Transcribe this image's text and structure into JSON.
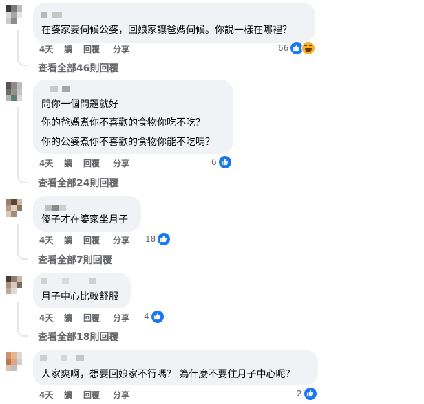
{
  "comments": [
    {
      "lines": [
        "在婆家要伺候公婆，回娘家讓爸媽伺候。你說一樣在哪裡？"
      ],
      "time": "4天",
      "read": "讀",
      "reply": "回覆",
      "share": "分享",
      "reaction_count": "66",
      "reactions": [
        "like-icon",
        "haha-icon"
      ],
      "view_replies": "查看全部46則回覆"
    },
    {
      "lines": [
        "問你一個問題就好",
        "你的爸媽煮你不喜歡的食物你吃不吃？",
        "你的公婆煮你不喜歡的食物你能不吃嗎？"
      ],
      "time": "4天",
      "read": "讀",
      "reply": "回覆",
      "share": "分享",
      "reaction_count": "6",
      "reactions": [
        "like-icon"
      ],
      "view_replies": "查看全部24則回覆"
    },
    {
      "lines": [
        "傻子才在婆家坐月子"
      ],
      "time": "4天",
      "read": "讀",
      "reply": "回覆",
      "share": "分享",
      "reaction_count": "18",
      "reactions": [
        "like-icon"
      ],
      "view_replies": "查看全部7則回覆"
    },
    {
      "lines": [
        "月子中心比較舒服"
      ],
      "time": "4天",
      "read": "讀",
      "reply": "回覆",
      "share": "分享",
      "reaction_count": "4",
      "reactions": [
        "like-icon"
      ],
      "view_replies": "查看全部18則回覆"
    },
    {
      "lines": [
        "人家爽啊，想要回娘家不行嗎？ 為什麼不要住月子中心呢？"
      ],
      "time": "4天",
      "read": "讀",
      "reply": "回覆",
      "share": "分享",
      "reaction_count": "2",
      "reactions": [
        "like-icon"
      ],
      "view_replies": ""
    }
  ],
  "colors": {
    "like": "#1877f2",
    "haha": "#f7b125",
    "bubble": "#f0f2f5",
    "meta": "#65676b"
  }
}
